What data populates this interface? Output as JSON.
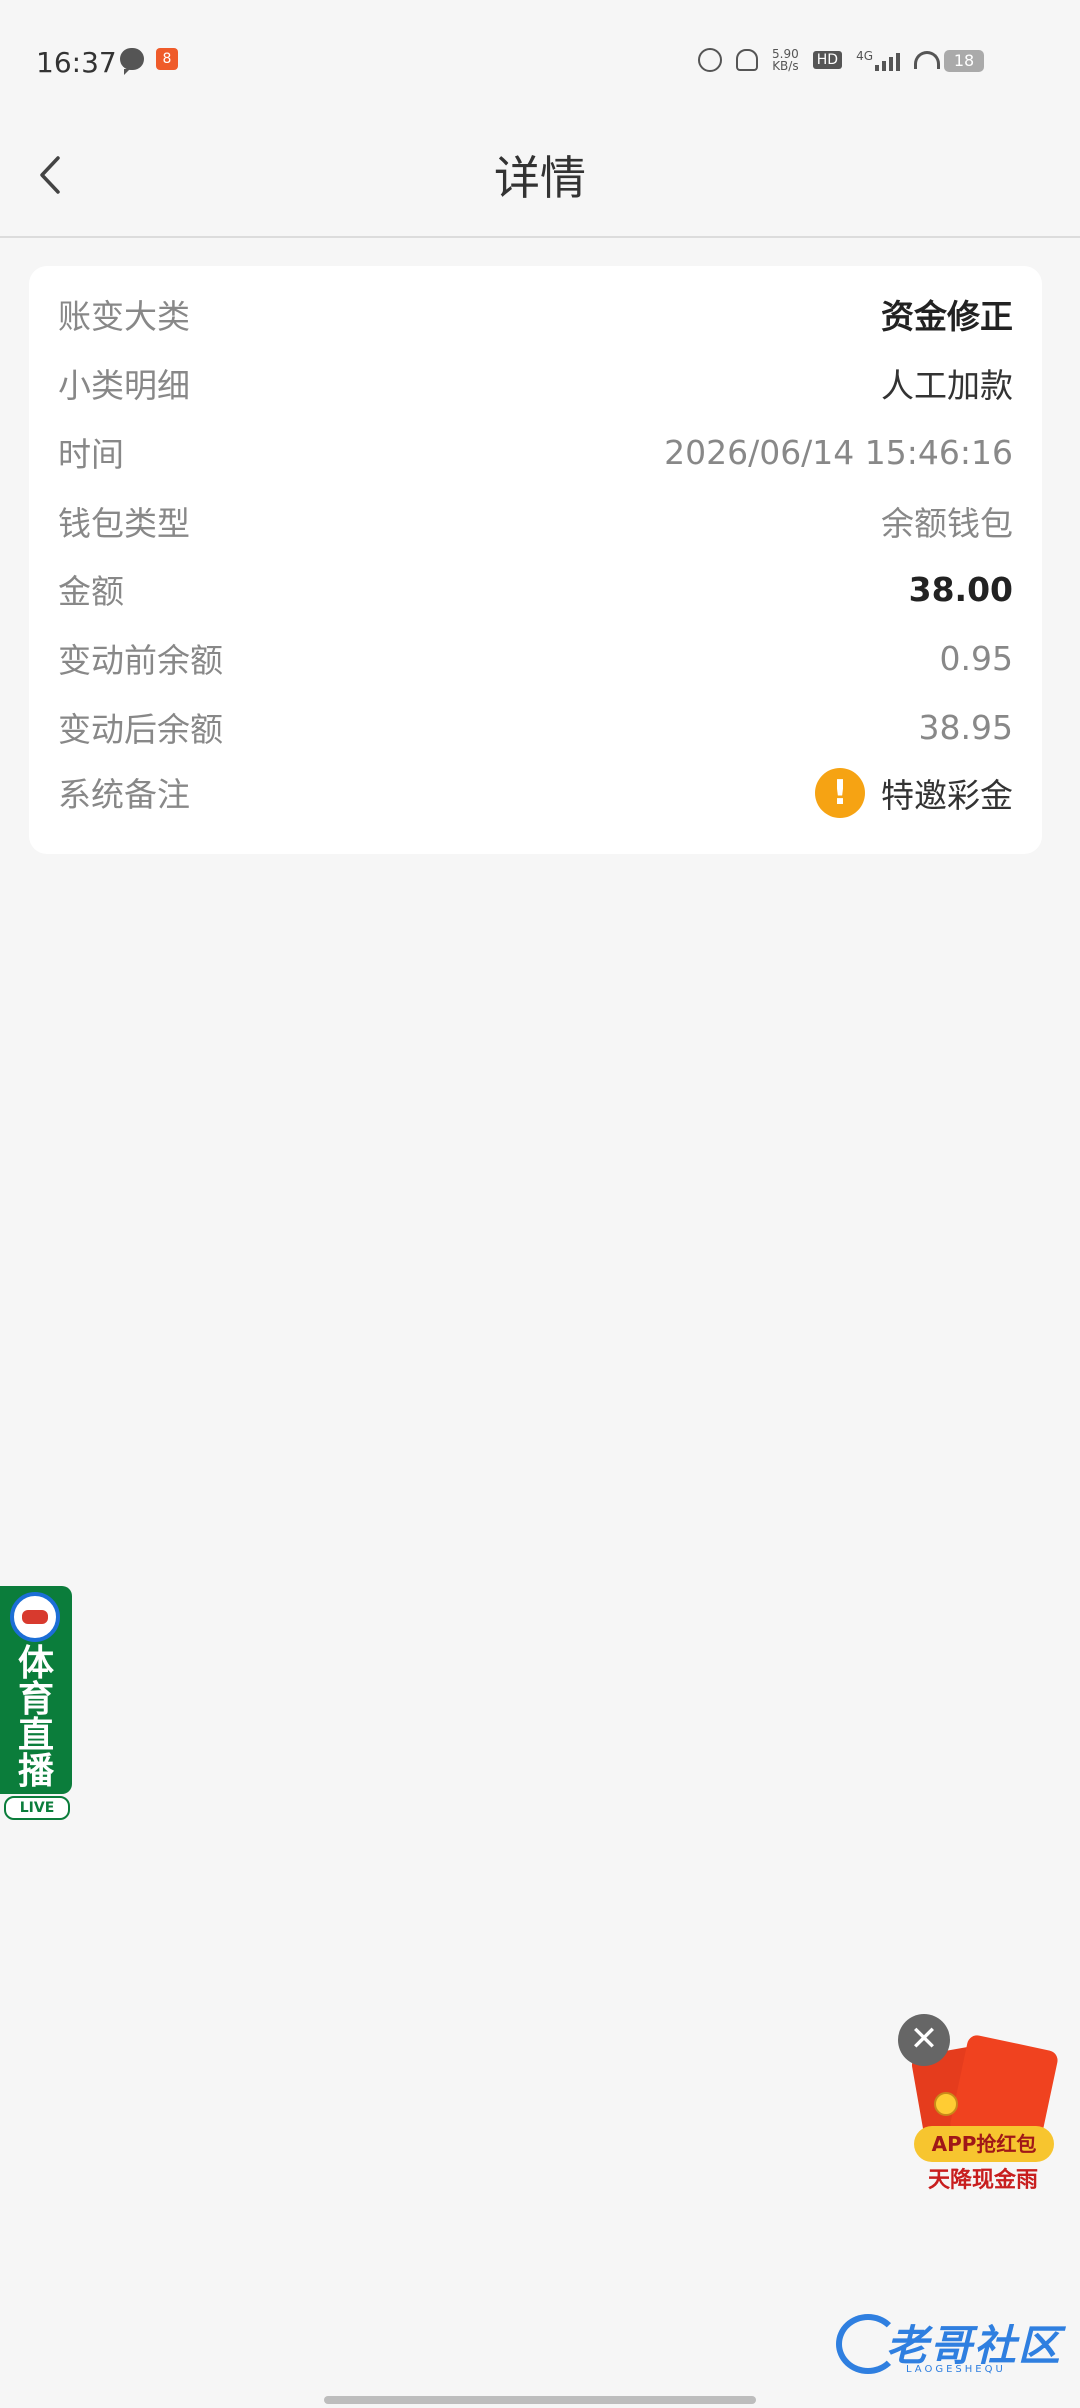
{
  "status_bar": {
    "time": "16:37",
    "network_speed": "5.90\nKB/s",
    "hd": "HD",
    "net_type": "4G",
    "battery": "18"
  },
  "header": {
    "title": "详情"
  },
  "details": [
    {
      "label": "账变大类",
      "value": "资金修正"
    },
    {
      "label": "小类明细",
      "value": "人工加款"
    },
    {
      "label": "时间",
      "value": "2026/06/14 15:46:16"
    },
    {
      "label": "钱包类型",
      "value": "余额钱包"
    },
    {
      "label": "金额",
      "value": "38.00"
    },
    {
      "label": "变动前余额",
      "value": "0.95"
    },
    {
      "label": "变动后余额",
      "value": "38.95"
    },
    {
      "label": "系统备注",
      "value": "特邀彩金"
    }
  ],
  "remark_icon": "!",
  "sports_badge": {
    "text": "体育直播",
    "live": "LIVE"
  },
  "red_packet": {
    "close": "✕",
    "badge": "APP抢红包",
    "subtitle": "天降现金雨"
  },
  "watermark": {
    "text": "老哥社区",
    "sub": "LAOGESHEQU"
  },
  "colors": {
    "background": "#f6f6f6",
    "card": "#ffffff",
    "warning": "#f6a313",
    "sports_green": "#0b7d3b",
    "logo_blue": "#2f7fe0"
  }
}
